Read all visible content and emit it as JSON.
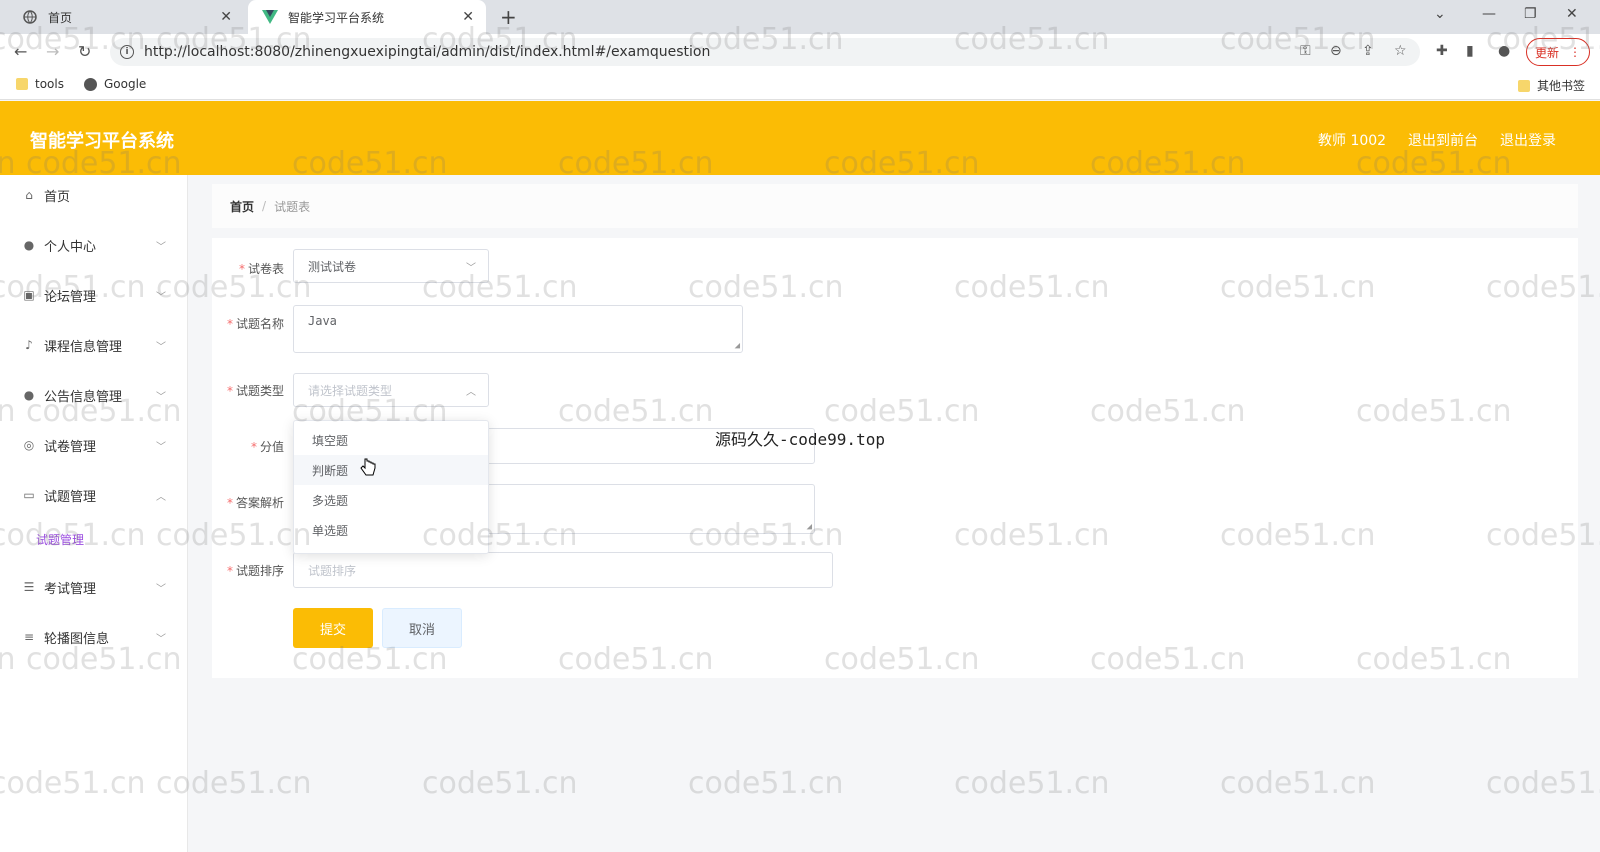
{
  "browser": {
    "tabs": [
      {
        "title": "首页"
      },
      {
        "title": "智能学习平台系统"
      }
    ],
    "new_tab": "+",
    "url": "http://localhost:8080/zhinengxuexipingtai/admin/dist/index.html#/examquestion",
    "update_label": "更新",
    "bookmarks": [
      {
        "label": "tools"
      },
      {
        "label": "Google"
      }
    ],
    "other_bookmarks": "其他书签"
  },
  "header": {
    "title": "智能学习平台系统",
    "user": "教师 1002",
    "to_front": "退出到前台",
    "logout": "退出登录"
  },
  "sidebar": {
    "items": [
      {
        "label": "首页",
        "icon": "home-icon"
      },
      {
        "label": "个人中心",
        "icon": "user-icon"
      },
      {
        "label": "论坛管理",
        "icon": "forum-icon"
      },
      {
        "label": "课程信息管理",
        "icon": "mic-icon"
      },
      {
        "label": "公告信息管理",
        "icon": "user-icon"
      },
      {
        "label": "试卷管理",
        "icon": "target-icon"
      },
      {
        "label": "试题管理",
        "icon": "chat-icon"
      },
      {
        "label": "考试管理",
        "icon": "sliders-icon"
      },
      {
        "label": "轮播图信息",
        "icon": "list-icon"
      }
    ],
    "submenu": {
      "label": "试题管理"
    }
  },
  "breadcrumb": {
    "home": "首页",
    "separator": "/",
    "current": "试题表"
  },
  "form": {
    "paper_label": "试卷表",
    "paper_value": "测试试卷",
    "name_label": "试题名称",
    "name_value": "Java",
    "type_label": "试题类型",
    "type_placeholder": "请选择试题类型",
    "score_label": "分值",
    "analysis_label": "答案解析",
    "order_label": "试题排序",
    "order_placeholder": "试题排序",
    "type_options": [
      "填空题",
      "判断题",
      "多选题",
      "单选题"
    ],
    "submit_label": "提交",
    "cancel_label": "取消"
  },
  "overlay": "源码久久-code99.top",
  "watermark": "code51.cn",
  "colors": {
    "accent": "#fbbc05",
    "required": "#f56c6c",
    "submenu_active": "#9b4de0"
  }
}
